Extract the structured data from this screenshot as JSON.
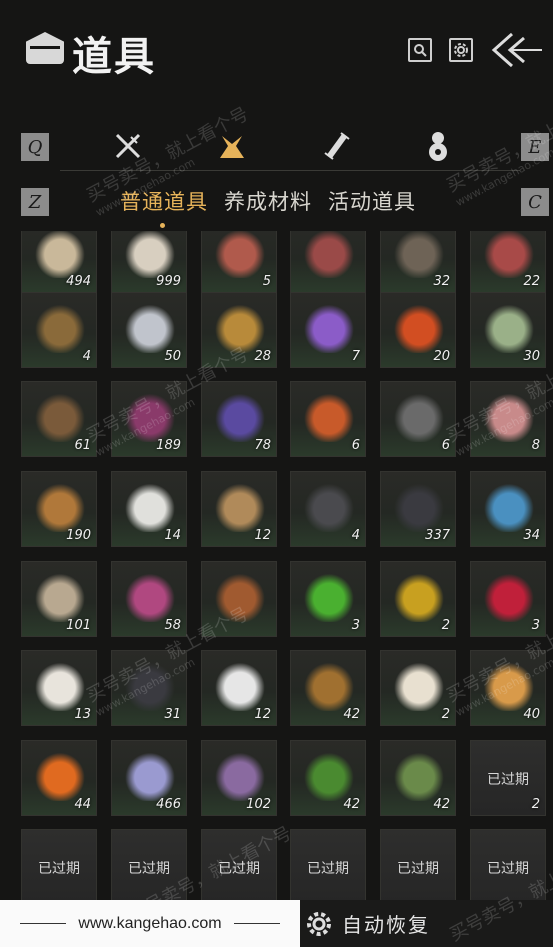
{
  "header": {
    "title": "道具"
  },
  "keys": {
    "left": "Q",
    "right": "E",
    "sub_left": "Z",
    "sub_right": "C"
  },
  "categories": [
    {
      "icon": "crossed-swords-icon"
    },
    {
      "icon": "cloth-bundle-icon",
      "active": true
    },
    {
      "icon": "scroll-icon"
    },
    {
      "icon": "gourd-icon"
    }
  ],
  "subtabs": [
    "普通道具",
    "养成材料",
    "活动道具"
  ],
  "active_subtab": 0,
  "items": [
    [
      "494",
      "999",
      "5",
      "",
      "32",
      "22"
    ],
    [
      "4",
      "50",
      "28",
      "7",
      "20",
      "30"
    ],
    [
      "61",
      "189",
      "78",
      "6",
      "6",
      "8"
    ],
    [
      "190",
      "14",
      "12",
      "4",
      "337",
      "34"
    ],
    [
      "101",
      "58",
      "",
      "3",
      "2",
      "3"
    ],
    [
      "13",
      "31",
      "12",
      "42",
      "2",
      "40"
    ],
    [
      "44",
      "466",
      "102",
      "42",
      "42",
      "2"
    ]
  ],
  "expired_label": "已过期",
  "watermark": {
    "text": "买号卖号，就上看个号",
    "url": "www.kangehao.com",
    "badge": "看个号"
  },
  "footer": {
    "url": "www.kangehao.com",
    "auto_restore": "自动恢复"
  },
  "colors": {
    "accent": "#e6b35a",
    "background": "#151514"
  }
}
